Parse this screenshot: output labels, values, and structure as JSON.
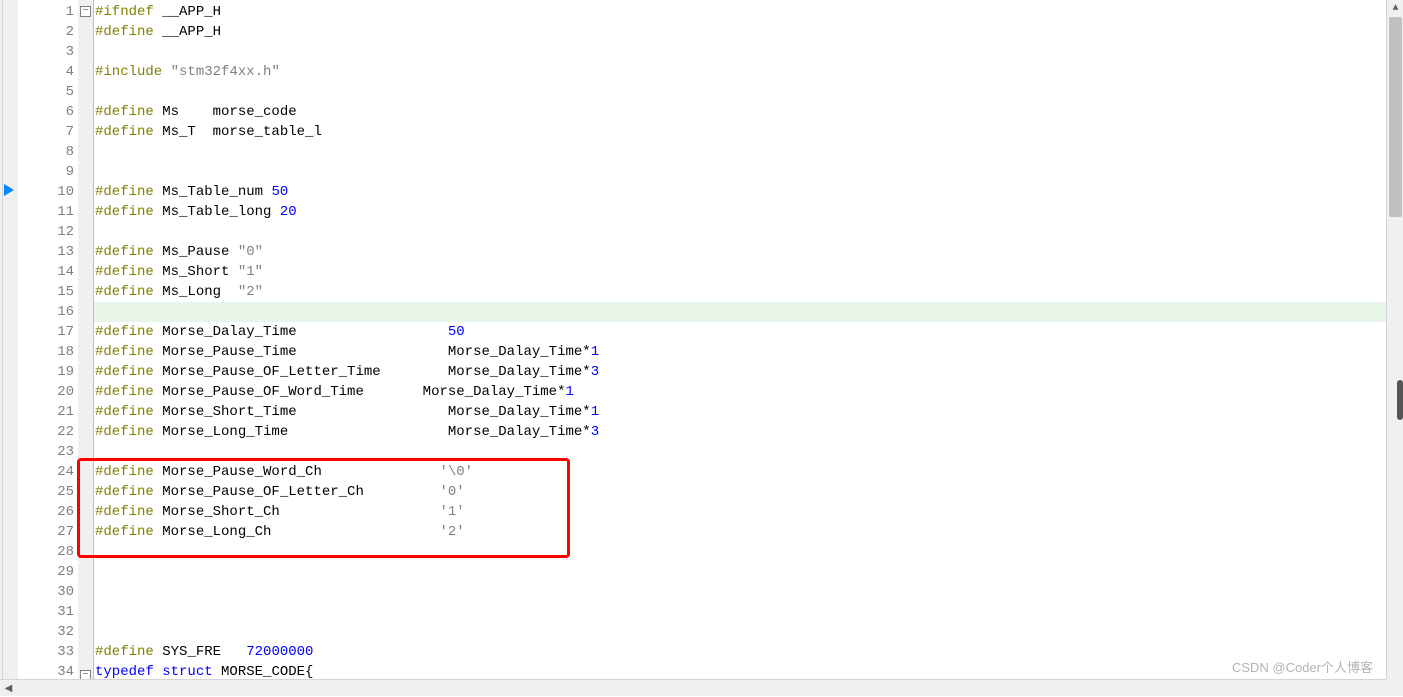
{
  "lines": [
    {
      "n": "1",
      "tokens": [
        {
          "t": "#ifndef ",
          "c": "tk-preproc"
        },
        {
          "t": "__APP_H",
          "c": "tk-ident"
        }
      ],
      "fold": "minus"
    },
    {
      "n": "2",
      "tokens": [
        {
          "t": "#define ",
          "c": "tk-preproc"
        },
        {
          "t": "__APP_H",
          "c": "tk-ident"
        }
      ]
    },
    {
      "n": "3",
      "tokens": []
    },
    {
      "n": "4",
      "tokens": [
        {
          "t": "#include ",
          "c": "tk-preproc"
        },
        {
          "t": "\"stm32f4xx.h\"",
          "c": "tk-string"
        }
      ]
    },
    {
      "n": "5",
      "tokens": []
    },
    {
      "n": "6",
      "tokens": [
        {
          "t": "#define ",
          "c": "tk-preproc"
        },
        {
          "t": "Ms    morse_code",
          "c": "tk-ident"
        }
      ]
    },
    {
      "n": "7",
      "tokens": [
        {
          "t": "#define ",
          "c": "tk-preproc"
        },
        {
          "t": "Ms_T  morse_table_l",
          "c": "tk-ident"
        }
      ]
    },
    {
      "n": "8",
      "tokens": []
    },
    {
      "n": "9",
      "tokens": []
    },
    {
      "n": "10",
      "tokens": [
        {
          "t": "#define ",
          "c": "tk-preproc"
        },
        {
          "t": "Ms_Table_num ",
          "c": "tk-ident"
        },
        {
          "t": "50",
          "c": "tk-number"
        }
      ]
    },
    {
      "n": "11",
      "tokens": [
        {
          "t": "#define ",
          "c": "tk-preproc"
        },
        {
          "t": "Ms_Table_long ",
          "c": "tk-ident"
        },
        {
          "t": "20",
          "c": "tk-number"
        }
      ]
    },
    {
      "n": "12",
      "tokens": []
    },
    {
      "n": "13",
      "tokens": [
        {
          "t": "#define ",
          "c": "tk-preproc"
        },
        {
          "t": "Ms_Pause ",
          "c": "tk-ident"
        },
        {
          "t": "\"0\"",
          "c": "tk-string"
        }
      ]
    },
    {
      "n": "14",
      "tokens": [
        {
          "t": "#define ",
          "c": "tk-preproc"
        },
        {
          "t": "Ms_Short ",
          "c": "tk-ident"
        },
        {
          "t": "\"1\"",
          "c": "tk-string"
        }
      ]
    },
    {
      "n": "15",
      "tokens": [
        {
          "t": "#define ",
          "c": "tk-preproc"
        },
        {
          "t": "Ms_Long  ",
          "c": "tk-ident"
        },
        {
          "t": "\"2\"",
          "c": "tk-string"
        }
      ]
    },
    {
      "n": "16",
      "tokens": [],
      "hl": true
    },
    {
      "n": "17",
      "tokens": [
        {
          "t": "#define ",
          "c": "tk-preproc"
        },
        {
          "t": "Morse_Dalay_Time                  ",
          "c": "tk-ident"
        },
        {
          "t": "50",
          "c": "tk-number"
        }
      ]
    },
    {
      "n": "18",
      "tokens": [
        {
          "t": "#define ",
          "c": "tk-preproc"
        },
        {
          "t": "Morse_Pause_Time                  Morse_Dalay_Time*",
          "c": "tk-ident"
        },
        {
          "t": "1",
          "c": "tk-number"
        }
      ]
    },
    {
      "n": "19",
      "tokens": [
        {
          "t": "#define ",
          "c": "tk-preproc"
        },
        {
          "t": "Morse_Pause_OF_Letter_Time        Morse_Dalay_Time*",
          "c": "tk-ident"
        },
        {
          "t": "3",
          "c": "tk-number"
        }
      ]
    },
    {
      "n": "20",
      "tokens": [
        {
          "t": "#define ",
          "c": "tk-preproc"
        },
        {
          "t": "Morse_Pause_OF_Word_Time       Morse_Dalay_Time*",
          "c": "tk-ident"
        },
        {
          "t": "1",
          "c": "tk-number"
        }
      ]
    },
    {
      "n": "21",
      "tokens": [
        {
          "t": "#define ",
          "c": "tk-preproc"
        },
        {
          "t": "Morse_Short_Time                  Morse_Dalay_Time*",
          "c": "tk-ident"
        },
        {
          "t": "1",
          "c": "tk-number"
        }
      ]
    },
    {
      "n": "22",
      "tokens": [
        {
          "t": "#define ",
          "c": "tk-preproc"
        },
        {
          "t": "Morse_Long_Time                   Morse_Dalay_Time*",
          "c": "tk-ident"
        },
        {
          "t": "3",
          "c": "tk-number"
        }
      ]
    },
    {
      "n": "23",
      "tokens": []
    },
    {
      "n": "24",
      "tokens": [
        {
          "t": "#define ",
          "c": "tk-preproc"
        },
        {
          "t": "Morse_Pause_Word_Ch              ",
          "c": "tk-ident"
        },
        {
          "t": "'\\0'",
          "c": "tk-char"
        }
      ]
    },
    {
      "n": "25",
      "tokens": [
        {
          "t": "#define ",
          "c": "tk-preproc"
        },
        {
          "t": "Morse_Pause_OF_Letter_Ch         ",
          "c": "tk-ident"
        },
        {
          "t": "'0'",
          "c": "tk-char"
        }
      ]
    },
    {
      "n": "26",
      "tokens": [
        {
          "t": "#define ",
          "c": "tk-preproc"
        },
        {
          "t": "Morse_Short_Ch                   ",
          "c": "tk-ident"
        },
        {
          "t": "'1'",
          "c": "tk-char"
        }
      ]
    },
    {
      "n": "27",
      "tokens": [
        {
          "t": "#define ",
          "c": "tk-preproc"
        },
        {
          "t": "Morse_Long_Ch                    ",
          "c": "tk-ident"
        },
        {
          "t": "'2'",
          "c": "tk-char"
        }
      ]
    },
    {
      "n": "28",
      "tokens": []
    },
    {
      "n": "29",
      "tokens": []
    },
    {
      "n": "30",
      "tokens": []
    },
    {
      "n": "31",
      "tokens": []
    },
    {
      "n": "32",
      "tokens": []
    },
    {
      "n": "33",
      "tokens": [
        {
          "t": "#define ",
          "c": "tk-preproc"
        },
        {
          "t": "SYS_FRE   ",
          "c": "tk-ident"
        },
        {
          "t": "72000000",
          "c": "tk-number"
        }
      ]
    },
    {
      "n": "34",
      "tokens": [
        {
          "t": "typedef struct ",
          "c": "tk-keyword"
        },
        {
          "t": "MORSE_CODE{",
          "c": "tk-type"
        }
      ],
      "fold": "minus"
    }
  ],
  "watermark": "CSDN @Coder个人博客"
}
